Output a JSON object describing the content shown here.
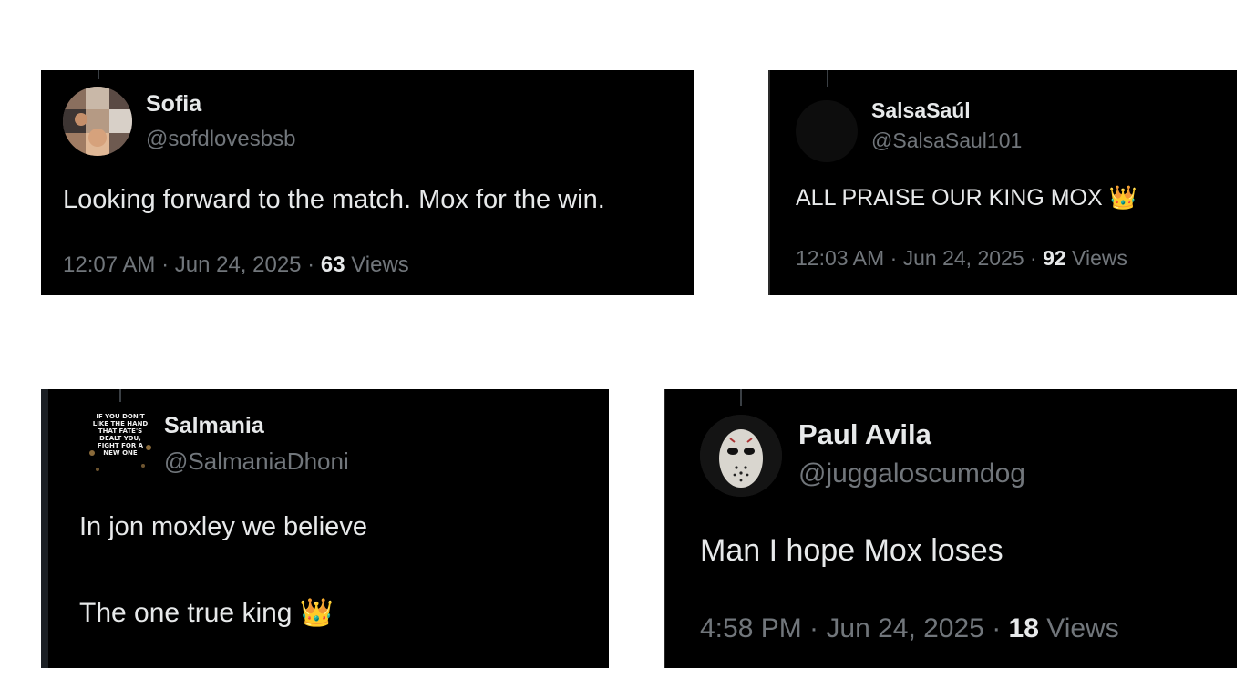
{
  "tweets": [
    {
      "name": "Sofia",
      "handle": "@sofdlovesbsb",
      "text": "Looking forward to the match. Mox for the win.",
      "time": "12:07 AM · Jun 24, 2025 · ",
      "views_count": "63",
      "views_label": " Views",
      "avatar": "collage-avatar"
    },
    {
      "name": "SalsaSaúl",
      "handle": "@SalsaSaul101",
      "text": "ALL PRAISE OUR KING MOX",
      "emoji": "👑",
      "emoji_icon": "crown-icon",
      "time": "12:03 AM · Jun 24, 2025 · ",
      "views_count": "92",
      "views_label": " Views",
      "avatar": "dark-avatar"
    },
    {
      "name": "Salmania",
      "handle": "@SalmaniaDhoni",
      "text_line1": "In jon moxley we believe",
      "text_line2": "The one true king",
      "emoji": "👑",
      "emoji_icon": "crown-icon",
      "avatar_text": "IF YOU DON'T LIKE THE HAND THAT FATE'S DEALT YOU, FIGHT FOR A NEW ONE",
      "avatar": "motto-avatar"
    },
    {
      "name": "Paul Avila",
      "handle": "@juggaloscumdog",
      "text": "Man I hope Mox loses",
      "time": "4:58 PM · Jun 24, 2025 · ",
      "views_count": "18",
      "views_label": " Views",
      "avatar": "hockey-mask-avatar"
    }
  ],
  "colors": {
    "card_bg": "#000000",
    "primary_text": "#e7e9ea",
    "secondary_text": "#71767b",
    "page_bg": "#ffffff"
  }
}
